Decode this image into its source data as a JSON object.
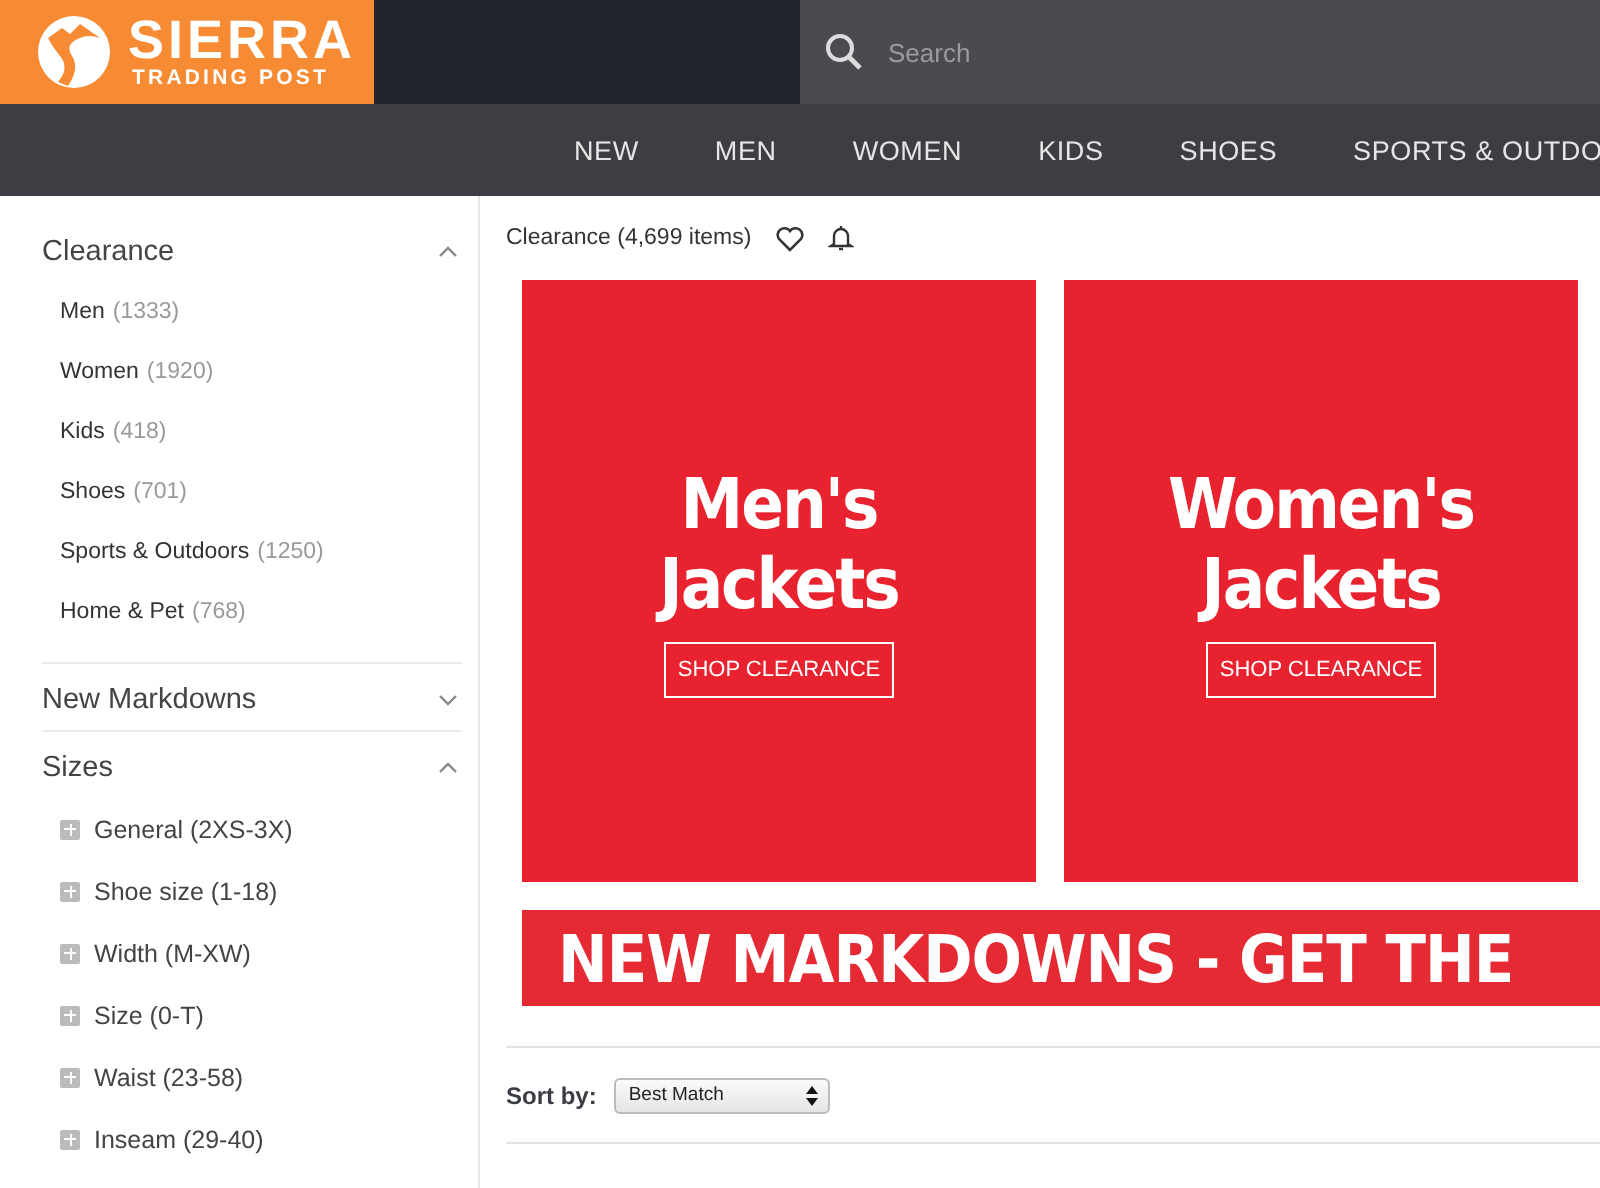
{
  "header": {
    "logo_title": "SIERRA",
    "logo_subtitle": "TRADING POST",
    "search": {
      "placeholder": "Search"
    }
  },
  "nav": [
    "NEW",
    "MEN",
    "WOMEN",
    "KIDS",
    "SHOES",
    "SPORTS & OUTDO"
  ],
  "sidebar": {
    "sections": [
      {
        "title": "Clearance",
        "expanded": true,
        "kind": "links",
        "items": [
          {
            "label": "Men",
            "count": "(1333)"
          },
          {
            "label": "Women",
            "count": "(1920)"
          },
          {
            "label": "Kids",
            "count": "(418)"
          },
          {
            "label": "Shoes",
            "count": "(701)"
          },
          {
            "label": "Sports & Outdoors",
            "count": "(1250)"
          },
          {
            "label": "Home & Pet",
            "count": "(768)"
          }
        ]
      },
      {
        "title": "New Markdowns",
        "expanded": false
      },
      {
        "title": "Sizes",
        "expanded": true,
        "kind": "expanders",
        "items": [
          {
            "label": "General (2XS-3X)"
          },
          {
            "label": "Shoe size (1-18)"
          },
          {
            "label": "Width (M-XW)"
          },
          {
            "label": "Size (0-T)"
          },
          {
            "label": "Waist (23-58)"
          },
          {
            "label": "Inseam (29-40)"
          }
        ]
      }
    ]
  },
  "results": {
    "title": "Clearance (4,699 items)"
  },
  "promos": [
    {
      "title": "Men's Jackets",
      "button": "SHOP CLEARANCE"
    },
    {
      "title": "Women's Jackets",
      "button": "SHOP CLEARANCE"
    }
  ],
  "banner": "NEW MARKDOWNS - GET THE",
  "sort": {
    "label": "Sort by:",
    "value": "Best Match"
  }
}
